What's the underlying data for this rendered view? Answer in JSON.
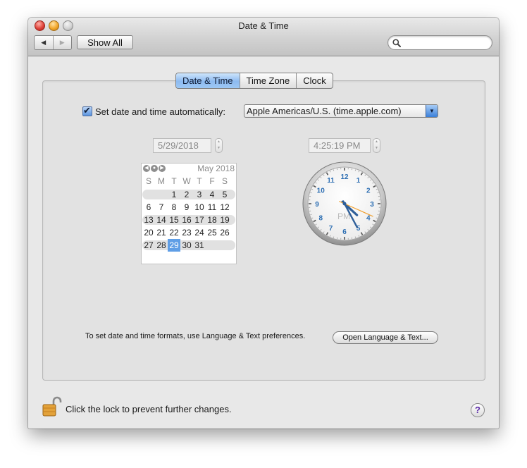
{
  "window": {
    "title": "Date & Time",
    "buttons": {
      "close": "close-button",
      "minimize": "minimize-button",
      "zoom": "zoom-button"
    }
  },
  "toolbar": {
    "back_icon": "◀",
    "forward_icon": "▶",
    "show_all_label": "Show All",
    "search_value": "",
    "search_icon": "magnifying-glass-icon"
  },
  "tabs": [
    {
      "label": "Date & Time",
      "selected": true
    },
    {
      "label": "Time Zone",
      "selected": false
    },
    {
      "label": "Clock",
      "selected": false
    }
  ],
  "auto": {
    "checked": true,
    "label": "Set date and time automatically:",
    "server": "Apple Americas/U.S. (time.apple.com)",
    "arrow": "▼"
  },
  "date_field": {
    "value": "5/29/2018"
  },
  "time_field": {
    "value": "4:25:19  PM"
  },
  "calendar": {
    "nav_icons": [
      "◀",
      "●",
      "▶"
    ],
    "month": "May 2018",
    "weekdays": [
      "S",
      "M",
      "T",
      "W",
      "T",
      "F",
      "S"
    ],
    "weeks": [
      [
        "",
        "",
        "1",
        "2",
        "3",
        "4",
        "5"
      ],
      [
        "6",
        "7",
        "8",
        "9",
        "10",
        "11",
        "12"
      ],
      [
        "13",
        "14",
        "15",
        "16",
        "17",
        "18",
        "19"
      ],
      [
        "20",
        "21",
        "22",
        "23",
        "24",
        "25",
        "26"
      ],
      [
        "27",
        "28",
        "29",
        "30",
        "31",
        "",
        ""
      ]
    ],
    "selected_day": "29"
  },
  "clock": {
    "numbers": [
      "12",
      "1",
      "2",
      "3",
      "4",
      "5",
      "6",
      "7",
      "8",
      "9",
      "10",
      "11"
    ],
    "period": "PM",
    "hours": 4,
    "minutes": 25,
    "seconds": 19
  },
  "formats": {
    "label": "To set date and time formats, use Language & Text preferences.",
    "button_label": "Open Language & Text..."
  },
  "footer": {
    "lock_label": "Click the lock to prevent further changes.",
    "help_label": "?"
  },
  "colors": {
    "selection_blue": "#5f9ee6",
    "clock_number_blue": "#2e6fb3",
    "second_hand_orange": "#f0a030"
  }
}
